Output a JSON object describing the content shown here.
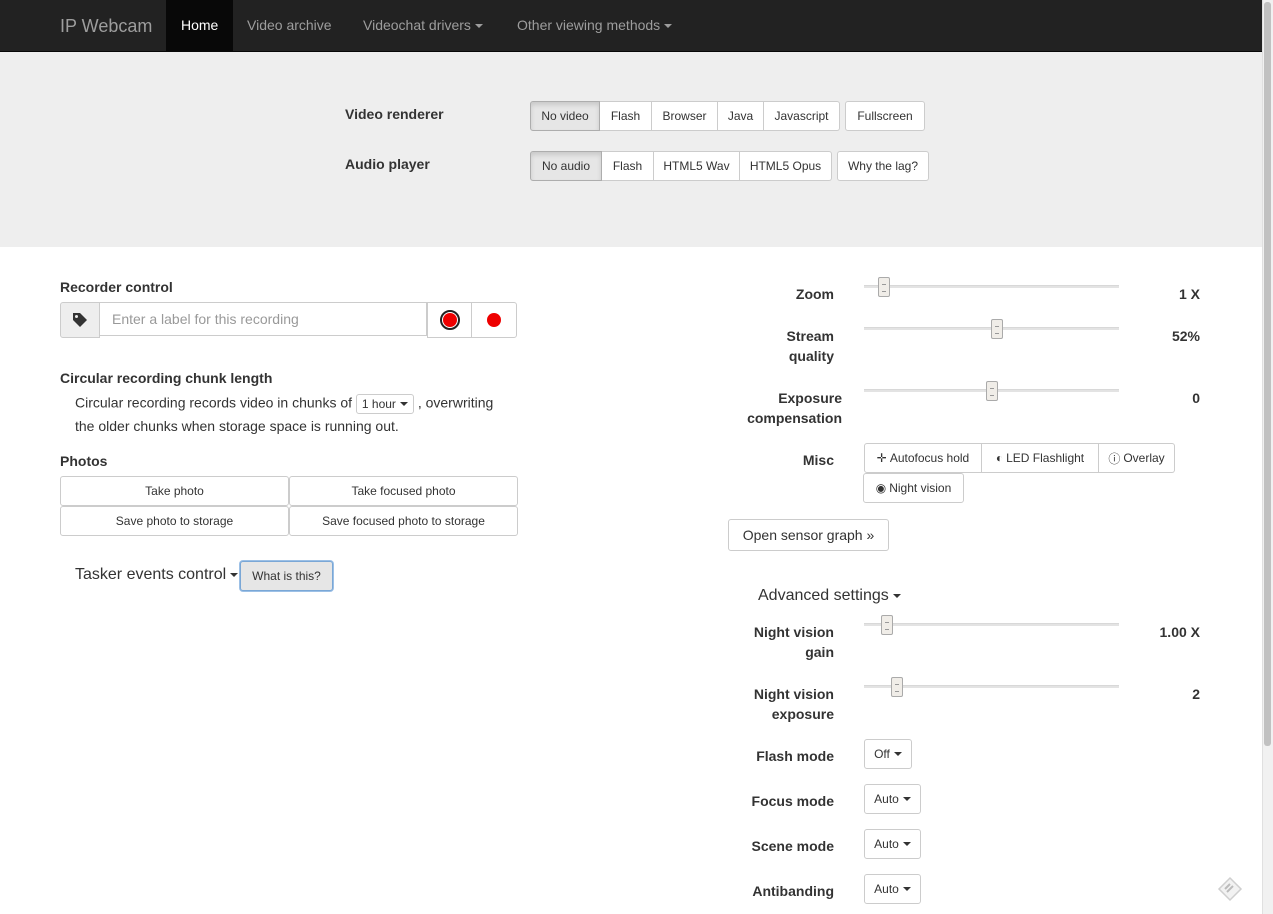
{
  "navbar": {
    "brand": "IP Webcam",
    "items": [
      {
        "label": "Home"
      },
      {
        "label": "Video archive"
      },
      {
        "label": "Videochat drivers"
      },
      {
        "label": "Other viewing methods"
      }
    ]
  },
  "renderer": {
    "video_label": "Video renderer",
    "video_options": [
      "No video",
      "Flash",
      "Browser",
      "Java",
      "Javascript"
    ],
    "fullscreen": "Fullscreen",
    "audio_label": "Audio player",
    "audio_options": [
      "No audio",
      "Flash",
      "HTML5 Wav",
      "HTML5 Opus"
    ],
    "why_lag": "Why the lag?"
  },
  "recorder": {
    "title": "Recorder control",
    "placeholder": "Enter a label for this recording"
  },
  "circular": {
    "title": "Circular recording chunk length",
    "text_before": "Circular recording records video in chunks of",
    "chunk_value": "1 hour",
    "text_after": ", overwriting",
    "text_line2": "the older chunks when storage space is running out."
  },
  "photos": {
    "title": "Photos",
    "take_photo": "Take photo",
    "take_focused": "Take focused photo",
    "save_photo": "Save photo to storage",
    "save_focused": "Save focused photo to storage"
  },
  "tasker": {
    "label": "Tasker events control",
    "what": "What is this?"
  },
  "controls": {
    "zoom": {
      "label": "Zoom",
      "value": "1 X",
      "level": 0.08
    },
    "quality": {
      "label1": "Stream",
      "label2": "quality",
      "value": "52%",
      "level": 0.52
    },
    "exposure": {
      "label1": "Exposure",
      "label2": "compensation",
      "value": "0",
      "level": 0.5
    },
    "misc_label": "Misc",
    "misc_buttons": [
      "Autofocus hold",
      "LED Flashlight",
      "Overlay",
      "Night vision"
    ],
    "sensor_graph": "Open sensor graph »"
  },
  "advanced": {
    "title": "Advanced settings",
    "nv_gain": {
      "label1": "Night vision",
      "label2": "gain",
      "value": "1.00 X",
      "level": 0.09
    },
    "nv_exposure": {
      "label1": "Night vision",
      "label2": "exposure",
      "value": "2",
      "level": 0.13
    },
    "flash_mode": {
      "label": "Flash mode",
      "value": "Off"
    },
    "focus_mode": {
      "label": "Focus mode",
      "value": "Auto"
    },
    "scene_mode": {
      "label": "Scene mode",
      "value": "Auto"
    },
    "antibanding": {
      "label": "Antibanding",
      "value": "Auto"
    }
  }
}
